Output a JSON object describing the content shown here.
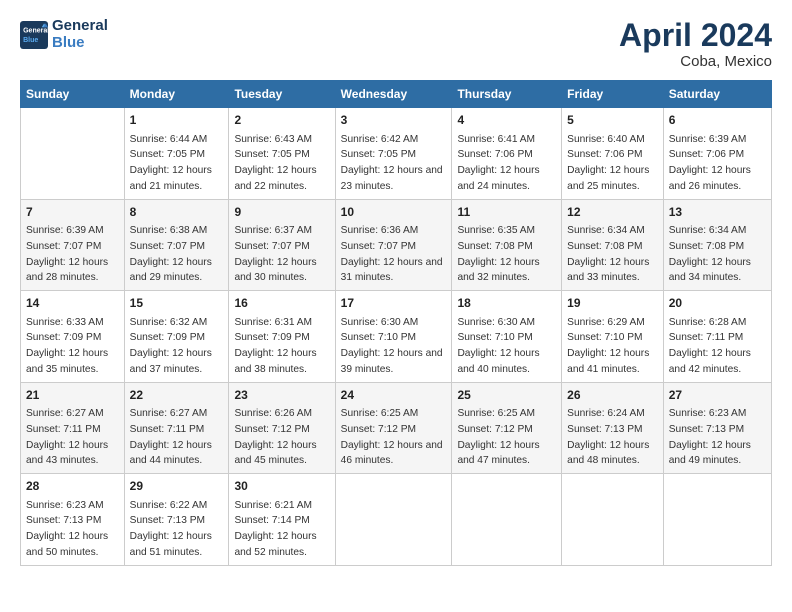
{
  "logo": {
    "line1": "General",
    "line2": "Blue"
  },
  "title": "April 2024",
  "subtitle": "Coba, Mexico",
  "days_of_week": [
    "Sunday",
    "Monday",
    "Tuesday",
    "Wednesday",
    "Thursday",
    "Friday",
    "Saturday"
  ],
  "weeks": [
    [
      {
        "day": "",
        "sunrise": "",
        "sunset": "",
        "daylight": ""
      },
      {
        "day": "1",
        "sunrise": "Sunrise: 6:44 AM",
        "sunset": "Sunset: 7:05 PM",
        "daylight": "Daylight: 12 hours and 21 minutes."
      },
      {
        "day": "2",
        "sunrise": "Sunrise: 6:43 AM",
        "sunset": "Sunset: 7:05 PM",
        "daylight": "Daylight: 12 hours and 22 minutes."
      },
      {
        "day": "3",
        "sunrise": "Sunrise: 6:42 AM",
        "sunset": "Sunset: 7:05 PM",
        "daylight": "Daylight: 12 hours and 23 minutes."
      },
      {
        "day": "4",
        "sunrise": "Sunrise: 6:41 AM",
        "sunset": "Sunset: 7:06 PM",
        "daylight": "Daylight: 12 hours and 24 minutes."
      },
      {
        "day": "5",
        "sunrise": "Sunrise: 6:40 AM",
        "sunset": "Sunset: 7:06 PM",
        "daylight": "Daylight: 12 hours and 25 minutes."
      },
      {
        "day": "6",
        "sunrise": "Sunrise: 6:39 AM",
        "sunset": "Sunset: 7:06 PM",
        "daylight": "Daylight: 12 hours and 26 minutes."
      }
    ],
    [
      {
        "day": "7",
        "sunrise": "Sunrise: 6:39 AM",
        "sunset": "Sunset: 7:07 PM",
        "daylight": "Daylight: 12 hours and 28 minutes."
      },
      {
        "day": "8",
        "sunrise": "Sunrise: 6:38 AM",
        "sunset": "Sunset: 7:07 PM",
        "daylight": "Daylight: 12 hours and 29 minutes."
      },
      {
        "day": "9",
        "sunrise": "Sunrise: 6:37 AM",
        "sunset": "Sunset: 7:07 PM",
        "daylight": "Daylight: 12 hours and 30 minutes."
      },
      {
        "day": "10",
        "sunrise": "Sunrise: 6:36 AM",
        "sunset": "Sunset: 7:07 PM",
        "daylight": "Daylight: 12 hours and 31 minutes."
      },
      {
        "day": "11",
        "sunrise": "Sunrise: 6:35 AM",
        "sunset": "Sunset: 7:08 PM",
        "daylight": "Daylight: 12 hours and 32 minutes."
      },
      {
        "day": "12",
        "sunrise": "Sunrise: 6:34 AM",
        "sunset": "Sunset: 7:08 PM",
        "daylight": "Daylight: 12 hours and 33 minutes."
      },
      {
        "day": "13",
        "sunrise": "Sunrise: 6:34 AM",
        "sunset": "Sunset: 7:08 PM",
        "daylight": "Daylight: 12 hours and 34 minutes."
      }
    ],
    [
      {
        "day": "14",
        "sunrise": "Sunrise: 6:33 AM",
        "sunset": "Sunset: 7:09 PM",
        "daylight": "Daylight: 12 hours and 35 minutes."
      },
      {
        "day": "15",
        "sunrise": "Sunrise: 6:32 AM",
        "sunset": "Sunset: 7:09 PM",
        "daylight": "Daylight: 12 hours and 37 minutes."
      },
      {
        "day": "16",
        "sunrise": "Sunrise: 6:31 AM",
        "sunset": "Sunset: 7:09 PM",
        "daylight": "Daylight: 12 hours and 38 minutes."
      },
      {
        "day": "17",
        "sunrise": "Sunrise: 6:30 AM",
        "sunset": "Sunset: 7:10 PM",
        "daylight": "Daylight: 12 hours and 39 minutes."
      },
      {
        "day": "18",
        "sunrise": "Sunrise: 6:30 AM",
        "sunset": "Sunset: 7:10 PM",
        "daylight": "Daylight: 12 hours and 40 minutes."
      },
      {
        "day": "19",
        "sunrise": "Sunrise: 6:29 AM",
        "sunset": "Sunset: 7:10 PM",
        "daylight": "Daylight: 12 hours and 41 minutes."
      },
      {
        "day": "20",
        "sunrise": "Sunrise: 6:28 AM",
        "sunset": "Sunset: 7:11 PM",
        "daylight": "Daylight: 12 hours and 42 minutes."
      }
    ],
    [
      {
        "day": "21",
        "sunrise": "Sunrise: 6:27 AM",
        "sunset": "Sunset: 7:11 PM",
        "daylight": "Daylight: 12 hours and 43 minutes."
      },
      {
        "day": "22",
        "sunrise": "Sunrise: 6:27 AM",
        "sunset": "Sunset: 7:11 PM",
        "daylight": "Daylight: 12 hours and 44 minutes."
      },
      {
        "day": "23",
        "sunrise": "Sunrise: 6:26 AM",
        "sunset": "Sunset: 7:12 PM",
        "daylight": "Daylight: 12 hours and 45 minutes."
      },
      {
        "day": "24",
        "sunrise": "Sunrise: 6:25 AM",
        "sunset": "Sunset: 7:12 PM",
        "daylight": "Daylight: 12 hours and 46 minutes."
      },
      {
        "day": "25",
        "sunrise": "Sunrise: 6:25 AM",
        "sunset": "Sunset: 7:12 PM",
        "daylight": "Daylight: 12 hours and 47 minutes."
      },
      {
        "day": "26",
        "sunrise": "Sunrise: 6:24 AM",
        "sunset": "Sunset: 7:13 PM",
        "daylight": "Daylight: 12 hours and 48 minutes."
      },
      {
        "day": "27",
        "sunrise": "Sunrise: 6:23 AM",
        "sunset": "Sunset: 7:13 PM",
        "daylight": "Daylight: 12 hours and 49 minutes."
      }
    ],
    [
      {
        "day": "28",
        "sunrise": "Sunrise: 6:23 AM",
        "sunset": "Sunset: 7:13 PM",
        "daylight": "Daylight: 12 hours and 50 minutes."
      },
      {
        "day": "29",
        "sunrise": "Sunrise: 6:22 AM",
        "sunset": "Sunset: 7:13 PM",
        "daylight": "Daylight: 12 hours and 51 minutes."
      },
      {
        "day": "30",
        "sunrise": "Sunrise: 6:21 AM",
        "sunset": "Sunset: 7:14 PM",
        "daylight": "Daylight: 12 hours and 52 minutes."
      },
      {
        "day": "",
        "sunrise": "",
        "sunset": "",
        "daylight": ""
      },
      {
        "day": "",
        "sunrise": "",
        "sunset": "",
        "daylight": ""
      },
      {
        "day": "",
        "sunrise": "",
        "sunset": "",
        "daylight": ""
      },
      {
        "day": "",
        "sunrise": "",
        "sunset": "",
        "daylight": ""
      }
    ]
  ]
}
